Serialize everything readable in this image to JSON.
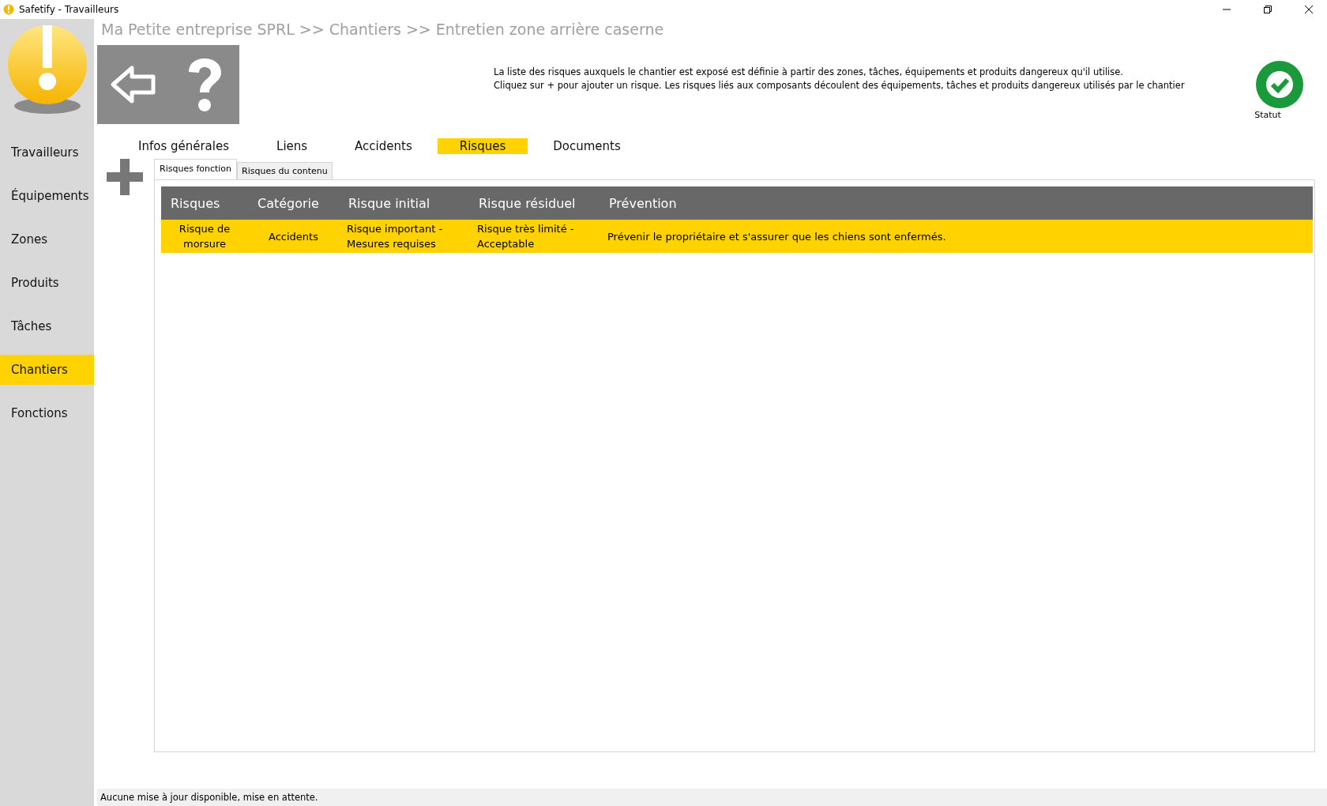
{
  "window": {
    "title": "Safetify - Travailleurs"
  },
  "sidebar": {
    "items": [
      {
        "label": "Travailleurs",
        "selected": false
      },
      {
        "label": "Équipements",
        "selected": false
      },
      {
        "label": "Zones",
        "selected": false
      },
      {
        "label": "Produits",
        "selected": false
      },
      {
        "label": "Tâches",
        "selected": false
      },
      {
        "label": "Chantiers",
        "selected": true
      },
      {
        "label": "Fonctions",
        "selected": false
      }
    ]
  },
  "breadcrumb": "Ma Petite entreprise SPRL >> Chantiers >> Entretien zone arrière caserne",
  "description": [
    "La liste des risques auxquels le chantier est exposé est définie à partir des zones, tâches, équipements et produits dangereux qu'il utilise.",
    "Cliquez sur + pour ajouter un risque. Les risques liés aux composants découlent des équipements, tâches et produits dangereux utilisés par le chantier"
  ],
  "status": {
    "label": "Statut"
  },
  "tabs": [
    {
      "label": "Infos générales",
      "selected": false
    },
    {
      "label": "Liens",
      "selected": false
    },
    {
      "label": "Accidents",
      "selected": false
    },
    {
      "label": "Risques",
      "selected": true
    },
    {
      "label": "Documents",
      "selected": false
    }
  ],
  "subtabs": [
    {
      "label": "Risques fonction",
      "selected": true
    },
    {
      "label": "Risques du contenu",
      "selected": false
    }
  ],
  "table": {
    "columns": [
      "Risques",
      "Catégorie",
      "Risque initial",
      "Risque résiduel",
      "Prévention"
    ],
    "rows": [
      {
        "cells": [
          "Risque de morsure",
          "Accidents",
          "Risque important - Mesures requises",
          "Risque très limité - Acceptable",
          "Prévenir le propriétaire et s'assurer que les chiens sont enfermés."
        ],
        "selected": true
      }
    ]
  },
  "status_bar": "Aucune mise à jour disponible, mise en attente."
}
